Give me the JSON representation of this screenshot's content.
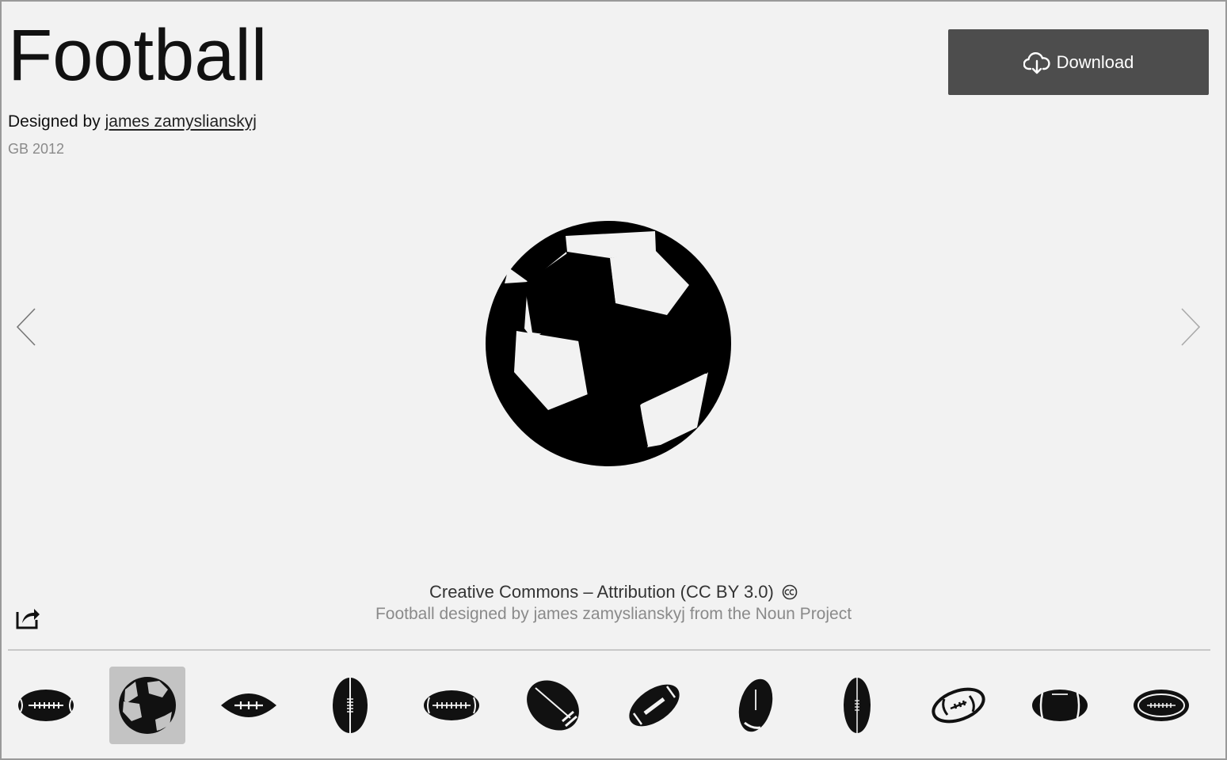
{
  "icon": {
    "title": "Football",
    "designed_by_label": "Designed by",
    "designer_name": "james zamyslianskyj",
    "meta": "GB 2012"
  },
  "actions": {
    "download_label": "Download"
  },
  "license": {
    "title": "Creative Commons – Attribution (CC BY 3.0)",
    "credit": "Football designed by james zamyslianskyj from the Noun Project"
  },
  "icons": {
    "prev": "chevron-left-icon",
    "next": "chevron-right-icon",
    "share": "share-icon",
    "download": "cloud-download-icon",
    "cc": "creative-commons-icon"
  },
  "thumbnails": [
    {
      "icon": "american-football-laces-icon",
      "selected": false
    },
    {
      "icon": "soccer-ball-icon",
      "selected": true
    },
    {
      "icon": "american-football-stitches-icon",
      "selected": false
    },
    {
      "icon": "rugby-ball-vertical-icon",
      "selected": false
    },
    {
      "icon": "american-football-long-laces-icon",
      "selected": false
    },
    {
      "icon": "american-football-tilted-stripe-icon",
      "selected": false
    },
    {
      "icon": "american-football-diagonal-icon",
      "selected": false
    },
    {
      "icon": "american-football-upright-icon",
      "selected": false
    },
    {
      "icon": "rugby-ball-narrow-icon",
      "selected": false
    },
    {
      "icon": "american-football-outline-icon",
      "selected": false
    },
    {
      "icon": "american-football-band-icon",
      "selected": false
    },
    {
      "icon": "american-football-outline-laces-icon",
      "selected": false
    }
  ],
  "colors": {
    "background": "#f2f2f2",
    "button": "#4d4d4d",
    "selected_thumb": "#c3c3c3",
    "muted_text": "#8a8a8a"
  }
}
